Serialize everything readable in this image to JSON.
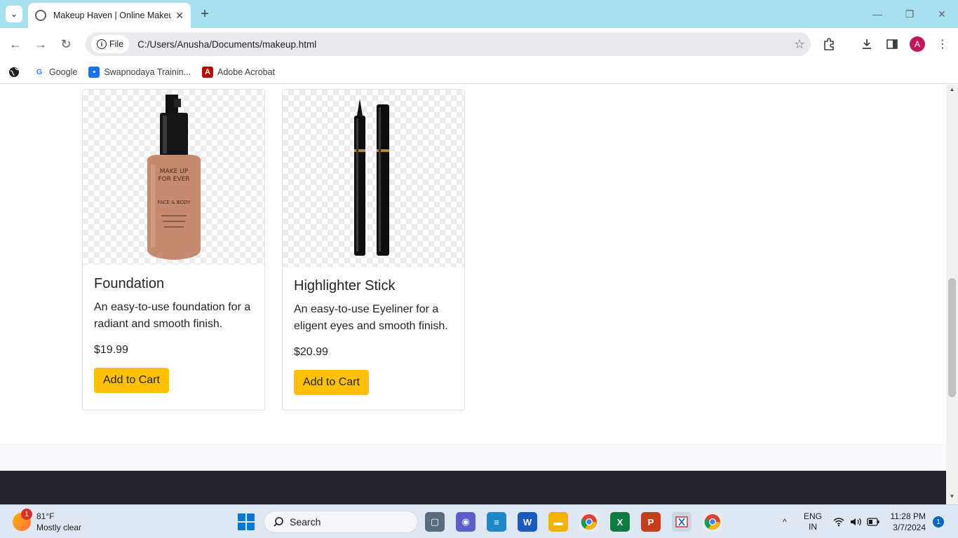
{
  "browser": {
    "tab_title": "Makeup Haven | Online Makeup",
    "tab_close": "✕",
    "new_tab": "+",
    "address_chip": "File",
    "url": "C:/Users/Anusha/Documents/makeup.html",
    "profile_initial": "A"
  },
  "bookmarks": [
    {
      "label": "Google",
      "icon": "google-icon"
    },
    {
      "label": "Swapnodaya Trainin...",
      "icon": "contact-card-icon"
    },
    {
      "label": "Adobe Acrobat",
      "icon": "adobe-acrobat-icon"
    }
  ],
  "products": [
    {
      "name": "Foundation",
      "description": "An easy-to-use foundation for a radiant and smooth finish.",
      "price": "$19.99",
      "button_label": "Add to Cart",
      "bottle_text": "MAKE UP FOR EVER FACE & BODY"
    },
    {
      "name": "Highlighter Stick",
      "description": "An easy-to-use Eyeliner for a eligent eyes and smooth finish.",
      "price": "$20.99",
      "button_label": "Add to Cart"
    }
  ],
  "taskbar": {
    "weather_temp": "81°F",
    "weather_desc": "Mostly clear",
    "weather_badge": "1",
    "search_label": "Search",
    "language_1": "ENG",
    "language_2": "IN",
    "time": "11:28 PM",
    "date": "3/7/2024",
    "notification_count": "1"
  },
  "colors": {
    "titlebar": "#a8e0f0",
    "cart_button": "#ffc107",
    "footer": "#212529",
    "taskbar": "#dfe8f2"
  }
}
